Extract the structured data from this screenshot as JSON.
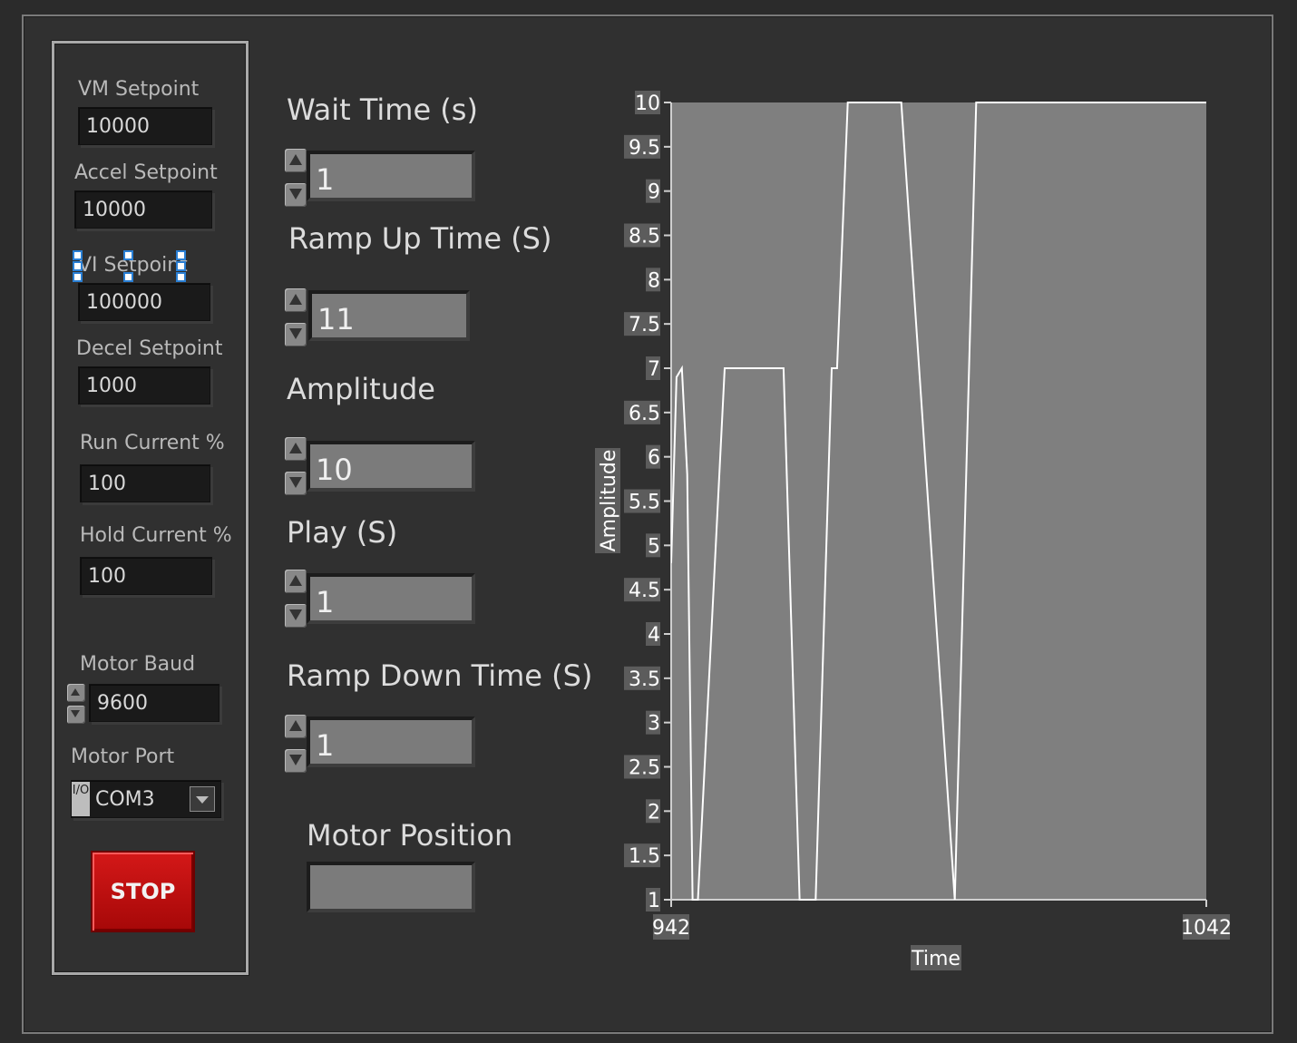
{
  "settings": {
    "vm_setpoint": {
      "label": "VM Setpoint",
      "value": "10000"
    },
    "accel_setpoint": {
      "label": "Accel Setpoint",
      "value": "10000"
    },
    "vi_setpoint": {
      "label": "VI Setpoint",
      "value": "100000"
    },
    "decel_setpoint": {
      "label": "Decel Setpoint",
      "value": "1000"
    },
    "run_current": {
      "label": "Run Current %",
      "value": "100"
    },
    "hold_current": {
      "label": "Hold Current %",
      "value": "100"
    },
    "motor_baud": {
      "label": "Motor Baud",
      "value": "9600"
    },
    "motor_port": {
      "label": "Motor Port",
      "value": "COM3",
      "prefix": "I/O"
    },
    "stop_label": "STOP"
  },
  "controls": {
    "wait_time": {
      "label": "Wait Time (s)",
      "value": "1"
    },
    "ramp_up_time": {
      "label": "Ramp Up Time (S)",
      "value": "11"
    },
    "amplitude": {
      "label": "Amplitude",
      "value": "10"
    },
    "play": {
      "label": "Play (S)",
      "value": "1"
    },
    "ramp_down_time": {
      "label": "Ramp Down Time (S)",
      "value": "1"
    },
    "motor_position": {
      "label": "Motor Position",
      "value": ""
    }
  },
  "colors": {
    "plot_bg": "#7f7f7f",
    "trace": "#ffffff",
    "stop_red": "#c41010"
  },
  "chart_data": {
    "type": "line",
    "xlabel": "Time",
    "ylabel": "Amplitude",
    "xlim": [
      942,
      1042
    ],
    "ylim": [
      1,
      10
    ],
    "x_ticks": [
      "942",
      "1042"
    ],
    "y_ticks": [
      "1",
      "1.5",
      "2",
      "2.5",
      "3",
      "3.5",
      "4",
      "4.5",
      "5",
      "5.5",
      "6",
      "6.5",
      "7",
      "7.5",
      "8",
      "8.5",
      "9",
      "9.5",
      "10"
    ],
    "grid": false,
    "series": [
      {
        "x": [
          942,
          943,
          944,
          945,
          946,
          947,
          952,
          963,
          966,
          969,
          972,
          973,
          975,
          979,
          985,
          990,
          995,
          999,
          1000,
          1050
        ],
        "y": [
          4.8,
          6.9,
          7,
          5.8,
          1,
          1,
          7,
          7,
          1,
          1,
          7,
          7,
          10,
          10,
          10,
          5.5,
          1,
          10,
          10,
          10
        ]
      }
    ]
  }
}
